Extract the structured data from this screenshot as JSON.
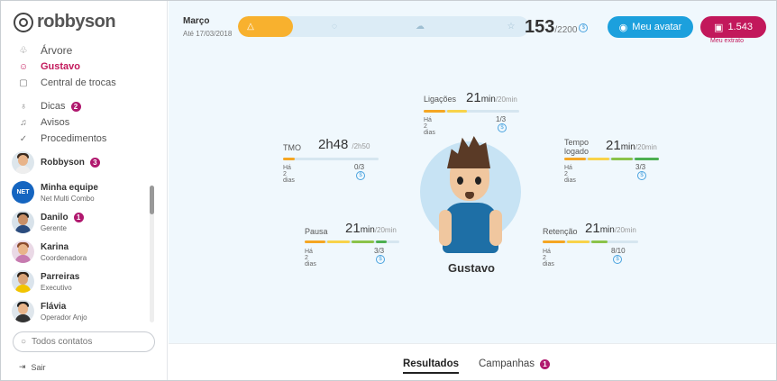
{
  "brand": {
    "name": "robbyson"
  },
  "nav": {
    "arvore": "Árvore",
    "user": "Gustavo",
    "trocas": "Central de trocas",
    "dicas": "Dicas",
    "dicas_badge": "2",
    "avisos": "Avisos",
    "procedimentos": "Procedimentos"
  },
  "contacts": {
    "robbyson": {
      "name": "Robbyson",
      "badge": "3"
    },
    "team": {
      "name": "Minha equipe",
      "sub": "Net Multi Combo",
      "logo": "NET"
    },
    "people": [
      {
        "name": "Danilo",
        "sub": "Gerente",
        "badge": "1"
      },
      {
        "name": "Karina",
        "sub": "Coordenadora"
      },
      {
        "name": "Parreiras",
        "sub": "Executivo"
      },
      {
        "name": "Flávia",
        "sub": "Operador Anjo"
      }
    ],
    "search_placeholder": "Todos contatos",
    "logout": "Sair"
  },
  "header": {
    "month": "Março",
    "until": "Até 17/03/2018",
    "progress_fraction": 0.19,
    "points": "153",
    "points_total": "/2200",
    "coin_symbol": "$",
    "avatar_button": "Meu avatar",
    "extrato_value": "1.543",
    "extrato_label": "Meu extrato"
  },
  "character": {
    "name": "Gustavo"
  },
  "metrics": {
    "ligacoes": {
      "label": "Ligações",
      "value": "21",
      "unit": "min",
      "target": "/20min",
      "ago": "Há 2 dias",
      "score": "1",
      "score_total": "/3"
    },
    "tmo": {
      "label": "TMO",
      "value": "2h48",
      "unit": "",
      "target": "/2h50",
      "ago": "Há 2 dias",
      "score": "0",
      "score_total": "/3"
    },
    "logado": {
      "label": "Tempo logado",
      "value": "21",
      "unit": "min",
      "target": "/20min",
      "ago": "Há 2 dias",
      "score": "3",
      "score_total": "/3"
    },
    "pausa": {
      "label": "Pausa",
      "value": "21",
      "unit": "min",
      "target": "/20min",
      "ago": "Há 2 dias",
      "score": "3",
      "score_total": "/3"
    },
    "retencao": {
      "label": "Retenção",
      "value": "21",
      "unit": "min",
      "target": "/20min",
      "ago": "Há 2 dias",
      "score": "8",
      "score_total": "/10"
    }
  },
  "tabs": {
    "resultados": "Resultados",
    "campanhas": "Campanhas",
    "campanhas_badge": "1"
  },
  "colors": {
    "accent_blue": "#1ca0dd",
    "accent_magenta": "#c2185b",
    "progress_yellow": "#f8b12e",
    "metric_green": "#4caf50"
  }
}
